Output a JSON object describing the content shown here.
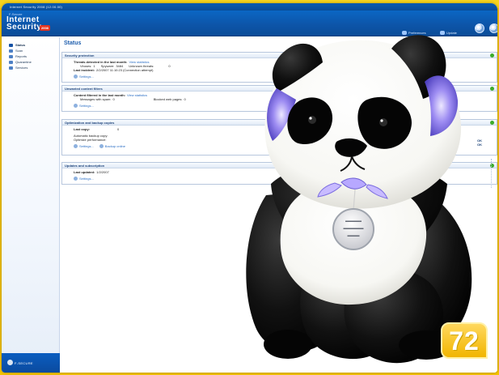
{
  "window": {
    "title": "Internet Security 2008 (12.00.00)"
  },
  "header": {
    "brand_small": "F-Secure",
    "brand_line1": "Internet",
    "brand_line2": "Security",
    "badge": "2008",
    "preferences": "Preferences",
    "update": "Update"
  },
  "sidebar": {
    "items": [
      {
        "label": "Status",
        "icon": "status-icon"
      },
      {
        "label": "Scan",
        "icon": "scan-icon"
      },
      {
        "label": "Reports",
        "icon": "reports-icon"
      },
      {
        "label": "Quarantine",
        "icon": "quarantine-icon"
      },
      {
        "label": "Services",
        "icon": "services-icon"
      }
    ],
    "vendor": "F-SECURE"
  },
  "main": {
    "title": "Status",
    "panels": [
      {
        "heading": "Security protection",
        "threats_label": "Threats detected in the last month:",
        "view_statistics": "View statistics",
        "viruses_label": "Viruses:",
        "viruses_value": "1",
        "spyware_label": "Spyware:",
        "spyware_value": "3484",
        "unknown_label": "Unknown threats:",
        "unknown_value": "0",
        "last_incident_label": "Last incident:",
        "last_incident_value": "2/2/2007 11:10:23 (Connection attempt)",
        "settings": "Settings..."
      },
      {
        "heading": "Unwanted content filters",
        "filtered_label": "Content filtered in the last month:",
        "view_statistics": "View statistics",
        "spam_label": "Messages with spam:",
        "spam_value": "0",
        "blocked_label": "Blocked web pages:",
        "blocked_value": "0",
        "settings": "Settings..."
      },
      {
        "heading": "Optimization and backup copies",
        "last_copy_label": "Last copy:",
        "last_copy_value": "0",
        "automatic_backup_label": "Automatic backup copy:",
        "automatic_backup_value": "OK",
        "optimize_label": "Optimize performance:",
        "optimize_value": "OK",
        "settings": "Settings...",
        "backup_online": "Backup online"
      },
      {
        "heading": "Updates and subscription",
        "last_updated_label": "Last updated:",
        "last_updated_value": "1/2/2007",
        "settings": "Settings..."
      }
    ]
  },
  "overlay": {
    "page_number": "72"
  },
  "colors": {
    "frame": "#f4c300",
    "header": "#0d55a8",
    "accent": "#2d70c5",
    "status_ok": "#3cad2b"
  }
}
